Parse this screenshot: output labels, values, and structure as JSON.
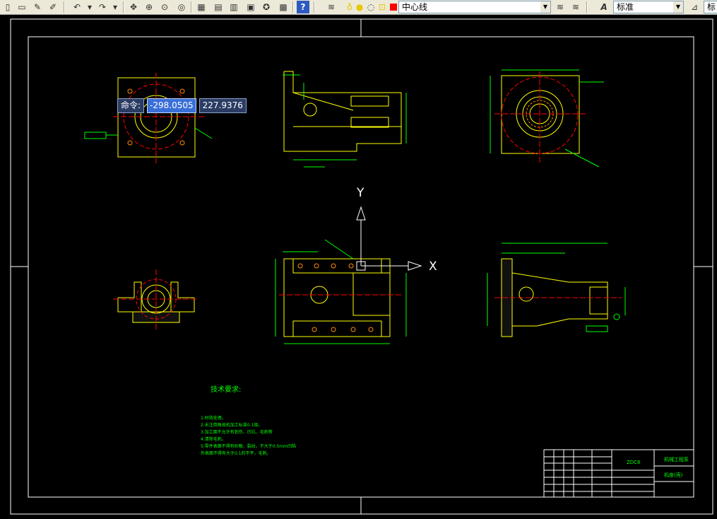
{
  "toolbar": {
    "layer_name": "中心线",
    "text_style": "标准",
    "right_style_label": "标",
    "colors": {
      "layer_icon_bulb": "#f5e24a",
      "layer_color_red": "#ff0000"
    }
  },
  "command_tooltip": {
    "label": "命令:",
    "x_value": "-298.0505",
    "y_value": "227.9376"
  },
  "ucs": {
    "x_label": "X",
    "y_label": "Y"
  },
  "drawing": {
    "tech_title": "技术要求:",
    "tech_notes": [
      "1.时效处理。",
      "2.未注倒角按机加工标准0-1级。",
      "3.加工面不允许有划伤、凹坑、毛刺等",
      "4.清除毛刺。",
      "5.零件表面不得有砂眼、裂纹，不大于0.5mm凹陷",
      "  外表面不得有大于0.1的不平，毛刺。"
    ],
    "title_block": {
      "part_code": "ZDC6",
      "company": "机械工程系",
      "part_name": "机座(壳)"
    },
    "colors": {
      "line": "#ffff00",
      "dim": "#00ff00",
      "center": "#ff0000",
      "frame": "#ffffff"
    }
  }
}
